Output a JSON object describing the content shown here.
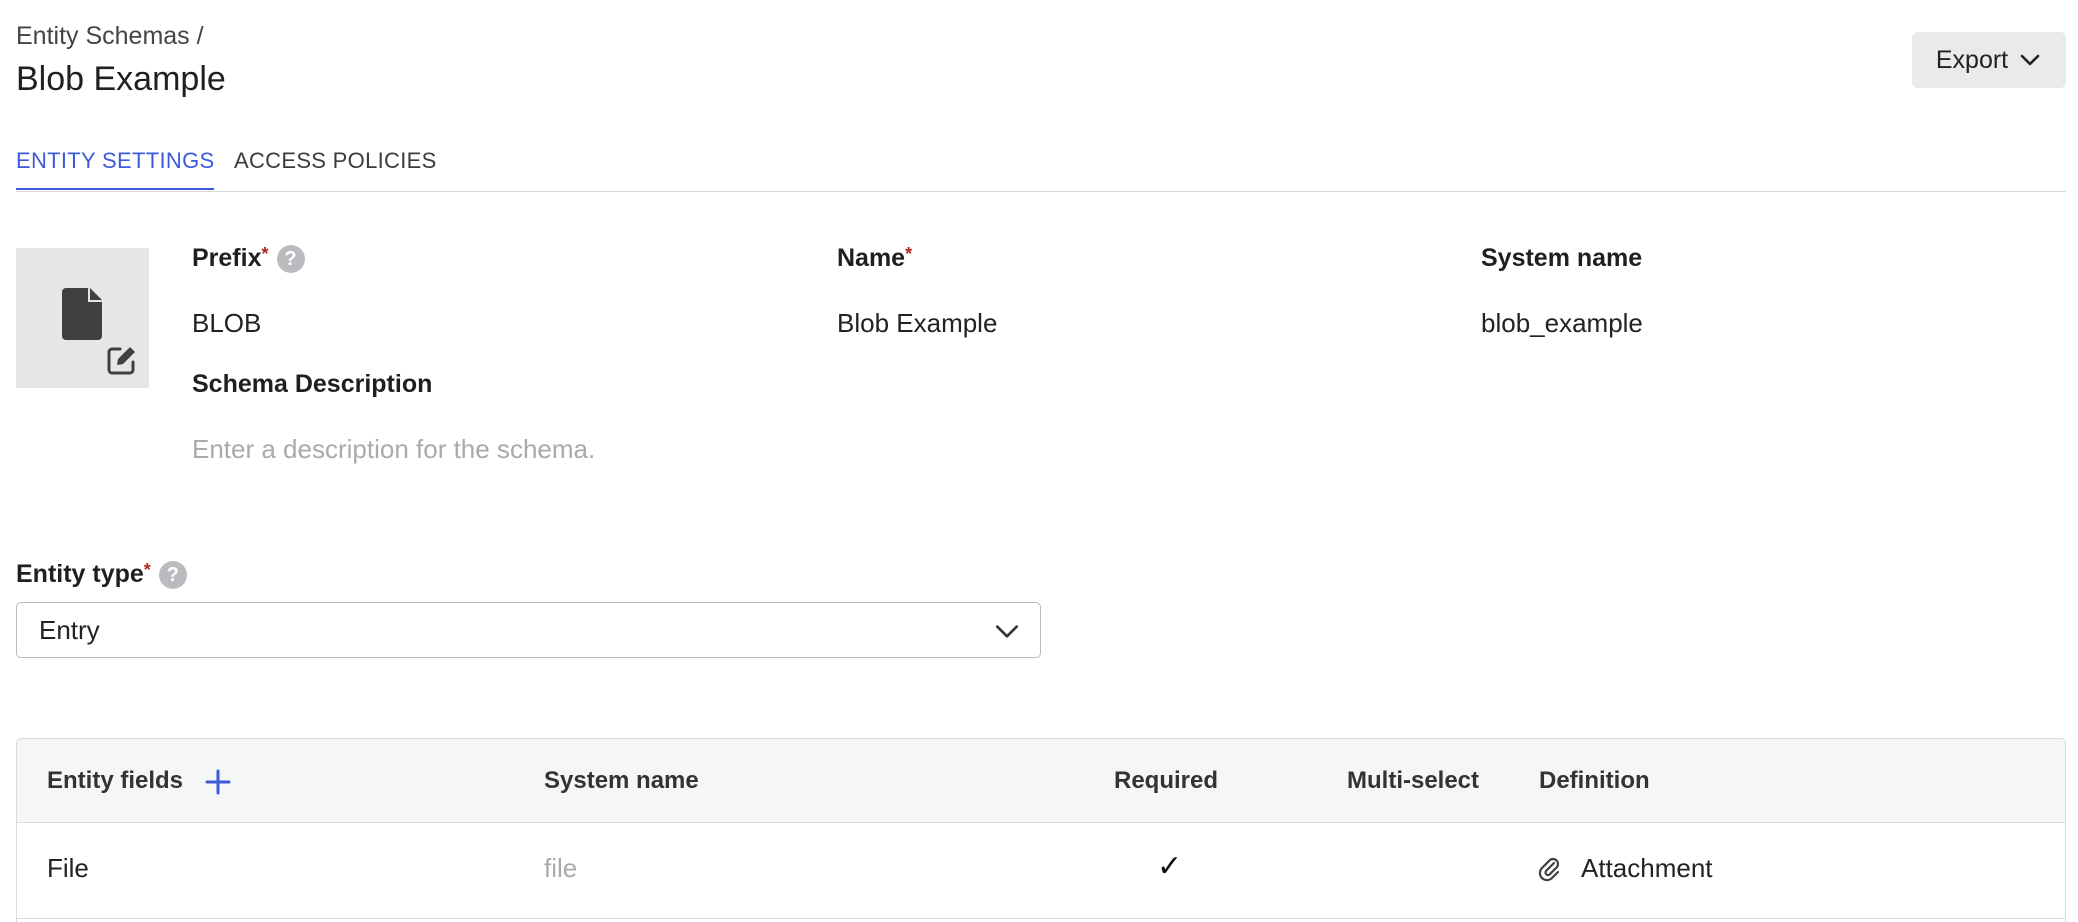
{
  "breadcrumb": "Entity Schemas /",
  "page_title": "Blob Example",
  "export_label": "Export",
  "tabs": [
    {
      "label": "ENTITY SETTINGS",
      "active": true
    },
    {
      "label": "ACCESS POLICIES",
      "active": false
    }
  ],
  "form": {
    "prefix_label": "Prefix",
    "prefix_value": "BLOB",
    "name_label": "Name",
    "name_value": "Blob Example",
    "system_name_label": "System name",
    "system_name_value": "blob_example",
    "description_label": "Schema Description",
    "description_placeholder": "Enter a description for the schema.",
    "required_mark": "*",
    "help_glyph": "?"
  },
  "entity_type": {
    "label": "Entity type",
    "value": "Entry"
  },
  "fields_table": {
    "headers": {
      "entity_fields": "Entity fields",
      "system_name": "System name",
      "required": "Required",
      "multi_select": "Multi-select",
      "definition": "Definition"
    },
    "rows": [
      {
        "name": "File",
        "system_name": "file",
        "required": "✓",
        "multi_select": "",
        "definition": "Attachment"
      }
    ]
  },
  "colors": {
    "accent": "#3d5bd9",
    "required": "#b3261e",
    "muted_text": "#a9aaad"
  },
  "icons": [
    "file-icon",
    "edit-icon",
    "chevron-down-icon",
    "help-icon",
    "plus-icon",
    "paperclip-icon"
  ]
}
